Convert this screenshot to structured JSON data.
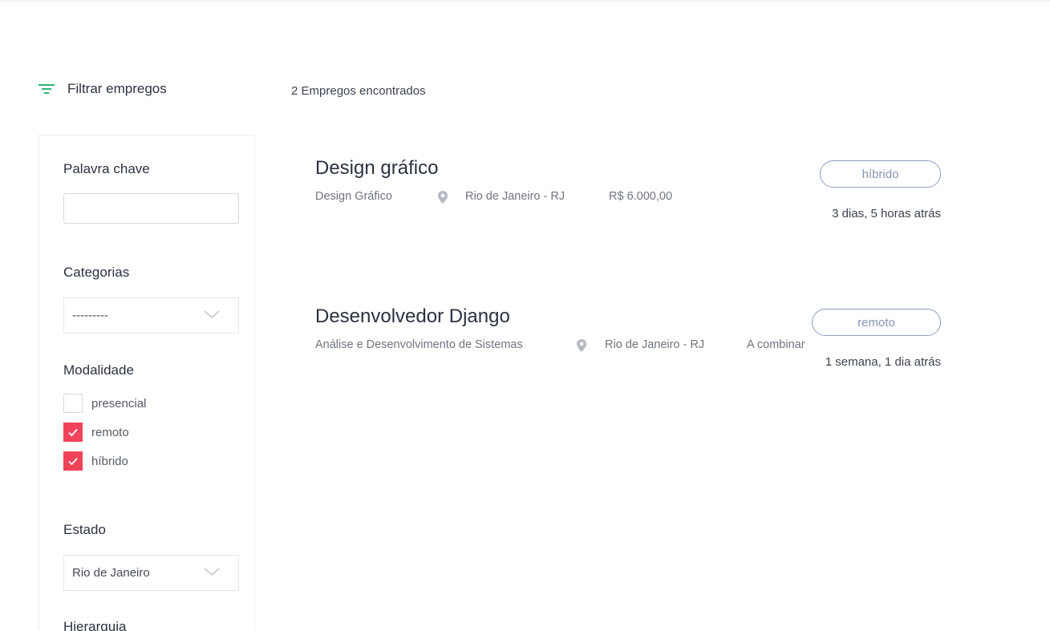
{
  "header": {
    "filter_title": "Filtrar empregos",
    "results_count": "2 Empregos encontrados"
  },
  "sidebar": {
    "keyword": {
      "label": "Palavra chave",
      "value": "",
      "placeholder": ""
    },
    "categories": {
      "label": "Categorias",
      "selected": "---------"
    },
    "modality": {
      "label": "Modalidade",
      "options": [
        {
          "label": "presencial",
          "checked": false
        },
        {
          "label": "remoto",
          "checked": true
        },
        {
          "label": "híbrido",
          "checked": true
        }
      ]
    },
    "state": {
      "label": "Estado",
      "selected": "Rio de Janeiro"
    },
    "hierarchy": {
      "label": "Hierarquia"
    }
  },
  "jobs": [
    {
      "title": "Design gráfico",
      "category": "Design Gráfico",
      "location": "Rio de Janeiro - RJ",
      "salary": "R$ 6.000,00",
      "modality": "híbrido",
      "posted": "3 dias, 5 horas atrás"
    },
    {
      "title": "Desenvolvedor Django",
      "category": "Análise e Desenvolvimento de Sistemas",
      "location": "Rio de Janeiro - RJ",
      "salary": "A combinar",
      "modality": "remoto",
      "posted": "1 semana, 1 dia atrás"
    }
  ],
  "colors": {
    "accent_green": "#2bb673",
    "checkbox_red": "#f0435a",
    "badge_border": "#8f9dbc"
  },
  "icons": {
    "filter": "filter-lines-icon",
    "location": "map-pin-icon",
    "dropdown": "chevron-down-icon",
    "check": "checkmark-icon"
  }
}
